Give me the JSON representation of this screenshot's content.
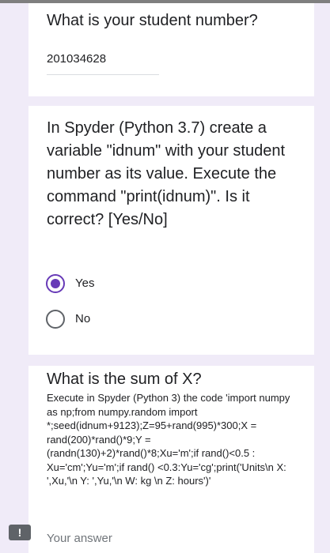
{
  "question1": {
    "title": "What is your student number?",
    "answer": "201034628"
  },
  "question2": {
    "title": "In Spyder (Python 3.7) create a variable \"idnum\" with your student number as its value. Execute the command \"print(idnum)\". Is it correct? [Yes/No]",
    "options": [
      {
        "label": "Yes",
        "selected": true
      },
      {
        "label": "No",
        "selected": false
      }
    ]
  },
  "question3": {
    "title": "What is the sum of X?",
    "description": "Execute in Spyder (Python 3) the code 'import numpy as np;from numpy.random import *;seed(idnum+9123);Z=95+rand(995)*300;X = rand(200)*rand()*9;Y = (randn(130)+2)*rand()*8;Xu='m';if rand()<0.5 : Xu='cm';Yu='m';if rand() <0.3:Yu='cg';print('Units\\n X: ',Xu,'\\n Y: ',Yu,'\\n W: kg \\n Z: hours')'",
    "placeholder": "Your answer"
  },
  "feedback_icon": "!",
  "colors": {
    "accent": "#673ab7",
    "background": "#f0ebf8"
  }
}
